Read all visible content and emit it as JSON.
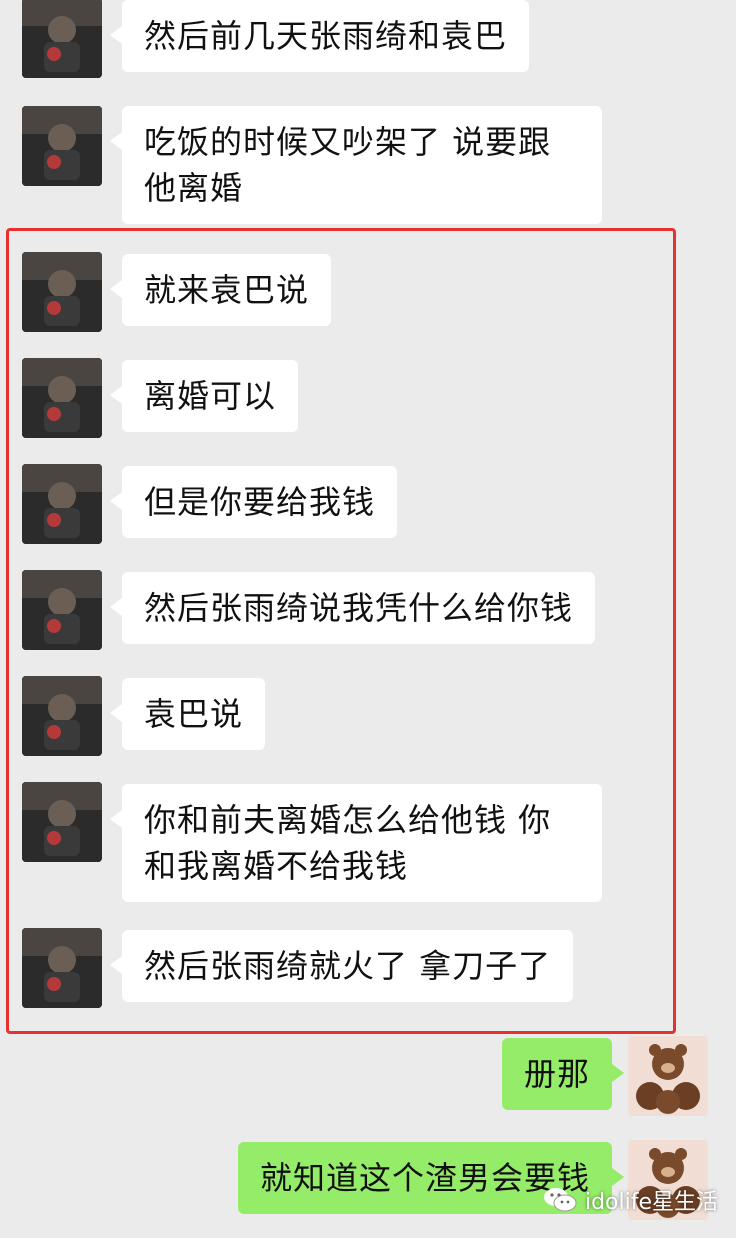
{
  "messages": [
    {
      "side": "in",
      "text": "然后前几天张雨绮和袁巴"
    },
    {
      "side": "in",
      "text": "吃饭的时候又吵架了 说要跟他离婚"
    },
    {
      "side": "in",
      "text": "就来袁巴说"
    },
    {
      "side": "in",
      "text": "离婚可以"
    },
    {
      "side": "in",
      "text": "但是你要给我钱"
    },
    {
      "side": "in",
      "text": "然后张雨绮说我凭什么给你钱"
    },
    {
      "side": "in",
      "text": "袁巴说"
    },
    {
      "side": "in",
      "text": "你和前夫离婚怎么给他钱 你和我离婚不给我钱"
    },
    {
      "side": "in",
      "text": "然后张雨绮就火了 拿刀子了"
    },
    {
      "side": "out",
      "text": "册那"
    },
    {
      "side": "out",
      "text": "就知道这个渣男会要钱"
    }
  ],
  "watermark": {
    "text": "idolife星生活",
    "icon": "wechat-icon"
  },
  "colors": {
    "background": "#ebebeb",
    "incoming_bubble": "#ffffff",
    "outgoing_bubble": "#95ec69",
    "highlight_border": "#e6322f"
  },
  "avatars": {
    "incoming": "dark-figure-avatar",
    "outgoing": "bear-sticker-avatar"
  }
}
